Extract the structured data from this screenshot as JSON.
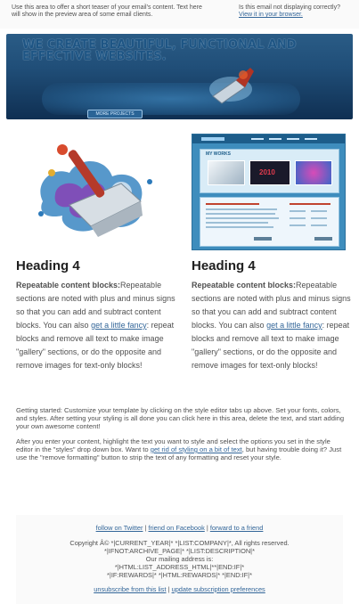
{
  "preheader": {
    "teaser": "Use this area to offer a short teaser of your email's content. Text here will show in the preview area of some email clients.",
    "not_displaying": "Is this email not displaying correctly?",
    "view_in_browser": "View it in your browser."
  },
  "hero": {
    "title": "WE CREATE BEAUTIFUL, FUNCTIONAL AND EFFECTIVE WEBSITES.",
    "more_button": "MORE PROJECTS"
  },
  "columns": [
    {
      "heading": "Heading 4",
      "strong": "Repeatable content blocks:",
      "text_1": "Repeatable sections are noted with plus and minus signs so that you can add and subtract content blocks. You can also ",
      "link": "get a little fancy",
      "text_2": ": repeat blocks and remove all text to make image \"gallery\" sections, or do the opposite and remove images for text-only blocks!"
    },
    {
      "heading": "Heading 4",
      "strong": "Repeatable content blocks:",
      "text_1": "Repeatable sections are noted with plus and minus signs so that you can add and subtract content blocks. You can also ",
      "link": "get a little fancy",
      "text_2": ": repeat blocks and remove all text to make image \"gallery\" sections, or do the opposite and remove images for text-only blocks!"
    }
  ],
  "screenshot": {
    "section_title": "MY WORKS",
    "number": "2010"
  },
  "body": {
    "para1": "Getting started: Customize your template by clicking on the style editor tabs up above. Set your fonts, colors, and styles. After setting your styling is all done you can click here in this area, delete the text, and start adding your own awesome content!",
    "para2_a": "After you enter your content, highlight the text you want to style and select the options you set in the style editor in the \"styles\" drop down box. Want to ",
    "para2_link": "get rid of styling on a bit of text",
    "para2_b": ", but having trouble doing it? Just use the \"remove formatting\" button to strip the text of any formatting and reset your style."
  },
  "footer": {
    "twitter": "follow on Twitter",
    "sep": " | ",
    "facebook": "friend on Facebook",
    "forward": "forward to a friend",
    "copyright": "Copyright Â© *|CURRENT_YEAR|* *|LIST:COMPANY|*, All rights reserved.",
    "archive": "*|IFNOT:ARCHIVE_PAGE|* *|LIST:DESCRIPTION|*",
    "address_label": "Our mailing address is:",
    "address": "*|HTML:LIST_ADDRESS_HTML|**|END:IF|*",
    "rewards": "*|IF:REWARDS|* *|HTML:REWARDS|* *|END:IF|*",
    "unsubscribe": "unsubscribe from this list",
    "update": "update subscription preferences"
  },
  "colors": {
    "link": "#336699",
    "text": "#505050",
    "heading": "#202020",
    "hero_bg": "#204e78"
  }
}
